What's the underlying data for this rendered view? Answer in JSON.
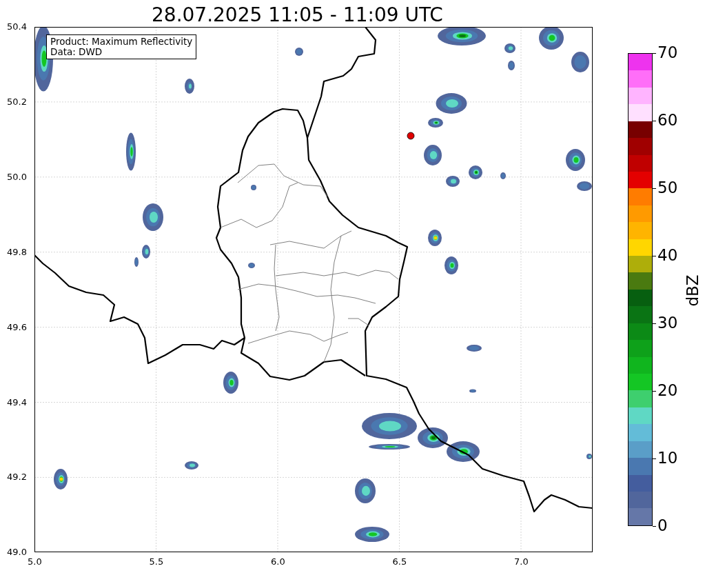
{
  "title": "28.07.2025 11:05 - 11:09 UTC",
  "info_box": [
    "Product: Maximum Reflectivity",
    "Data: DWD"
  ],
  "map": {
    "xticks": [
      "5.0",
      "5.5",
      "6.0",
      "6.5",
      "7.0"
    ],
    "yticks": [
      "50.4",
      "50.2",
      "50.0",
      "49.8",
      "49.6",
      "49.4",
      "49.2",
      "49.0"
    ]
  },
  "colorbar": {
    "label": "dBZ",
    "ticks": [
      "70",
      "60",
      "50",
      "40",
      "30",
      "20",
      "10",
      "0"
    ],
    "segments": [
      {
        "color": "#ee33ee"
      },
      {
        "color": "#ff6ef8"
      },
      {
        "color": "#ffb4ff"
      },
      {
        "color": "#ffe0ff"
      },
      {
        "color": "#780000"
      },
      {
        "color": "#a00000"
      },
      {
        "color": "#c00000"
      },
      {
        "color": "#e40000"
      },
      {
        "color": "#ff7c00"
      },
      {
        "color": "#ff9a00"
      },
      {
        "color": "#ffb400"
      },
      {
        "color": "#ffd600"
      },
      {
        "color": "#aeae0a"
      },
      {
        "color": "#4a7a10"
      },
      {
        "color": "#075f10"
      },
      {
        "color": "#0a7414"
      },
      {
        "color": "#0c8a16"
      },
      {
        "color": "#0ea11a"
      },
      {
        "color": "#10b51e"
      },
      {
        "color": "#14c624"
      },
      {
        "color": "#3ecf6e"
      },
      {
        "color": "#5fd8c4"
      },
      {
        "color": "#63bcd8"
      },
      {
        "color": "#5a9ec8"
      },
      {
        "color": "#4a78b0"
      },
      {
        "color": "#445d9e"
      },
      {
        "color": "#51669c"
      },
      {
        "color": "#6577a8"
      }
    ]
  }
}
